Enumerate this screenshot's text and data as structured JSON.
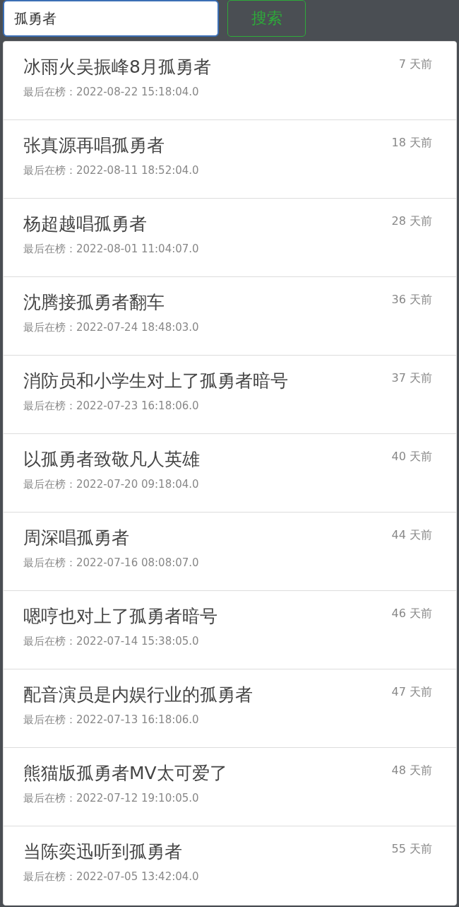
{
  "search": {
    "value": "孤勇者",
    "button": "搜索"
  },
  "results": [
    {
      "title": "冰雨火吴振峰8月孤勇者",
      "last_seen": "最后在榜：2022-08-22 15:18:04.0",
      "age": "7 天前"
    },
    {
      "title": "张真源再唱孤勇者",
      "last_seen": "最后在榜：2022-08-11 18:52:04.0",
      "age": "18 天前"
    },
    {
      "title": "杨超越唱孤勇者",
      "last_seen": "最后在榜：2022-08-01 11:04:07.0",
      "age": "28 天前"
    },
    {
      "title": "沈腾接孤勇者翻车",
      "last_seen": "最后在榜：2022-07-24 18:48:03.0",
      "age": "36 天前"
    },
    {
      "title": "消防员和小学生对上了孤勇者暗号",
      "last_seen": "最后在榜：2022-07-23 16:18:06.0",
      "age": "37 天前"
    },
    {
      "title": "以孤勇者致敬凡人英雄",
      "last_seen": "最后在榜：2022-07-20 09:18:04.0",
      "age": "40 天前"
    },
    {
      "title": "周深唱孤勇者",
      "last_seen": "最后在榜：2022-07-16 08:08:07.0",
      "age": "44 天前"
    },
    {
      "title": "嗯哼也对上了孤勇者暗号",
      "last_seen": "最后在榜：2022-07-14 15:38:05.0",
      "age": "46 天前"
    },
    {
      "title": "配音演员是内娱行业的孤勇者",
      "last_seen": "最后在榜：2022-07-13 16:18:06.0",
      "age": "47 天前"
    },
    {
      "title": "熊猫版孤勇者MV太可爱了",
      "last_seen": "最后在榜：2022-07-12 19:10:05.0",
      "age": "48 天前"
    },
    {
      "title": "当陈奕迅听到孤勇者",
      "last_seen": "最后在榜：2022-07-05 13:42:04.0",
      "age": "55 天前"
    }
  ]
}
